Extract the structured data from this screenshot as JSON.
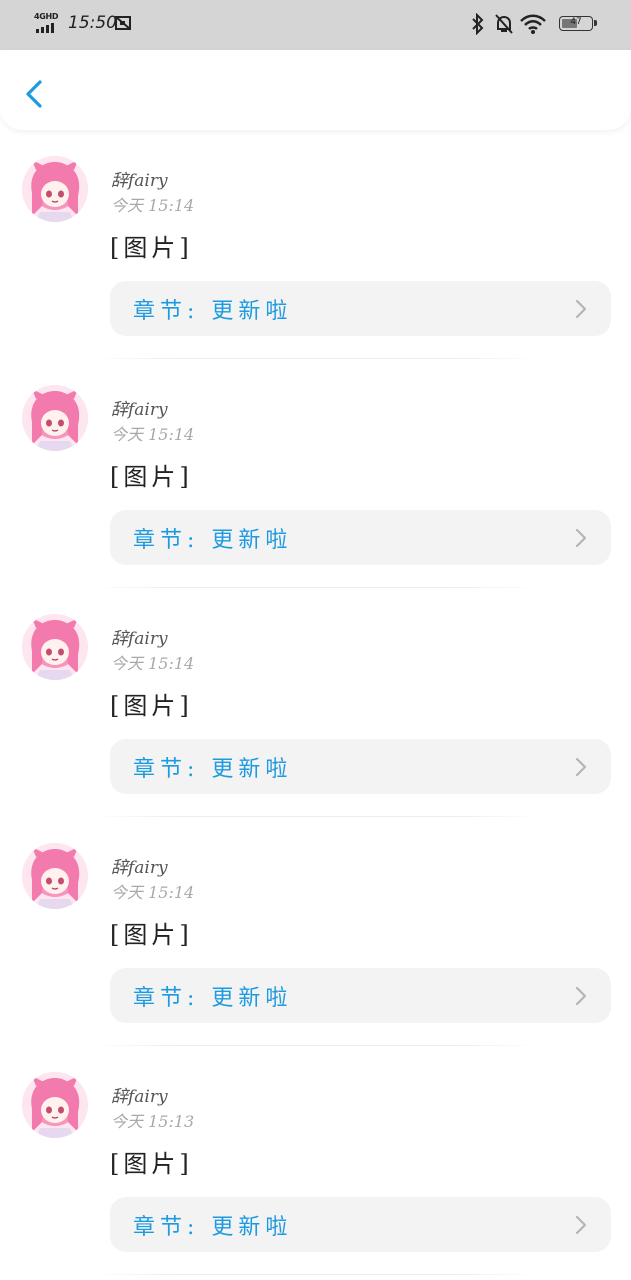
{
  "status_bar": {
    "network": "4GHD",
    "time": "15:50",
    "battery": "47",
    "battery_level": 0.47
  },
  "items": [
    {
      "name": "辞fairy",
      "time": "今天 15:14",
      "content": "[图片]",
      "chapter": "章节: 更新啦"
    },
    {
      "name": "辞fairy",
      "time": "今天 15:14",
      "content": "[图片]",
      "chapter": "章节: 更新啦"
    },
    {
      "name": "辞fairy",
      "time": "今天 15:14",
      "content": "[图片]",
      "chapter": "章节: 更新啦"
    },
    {
      "name": "辞fairy",
      "time": "今天 15:14",
      "content": "[图片]",
      "chapter": "章节: 更新啦"
    },
    {
      "name": "辞fairy",
      "time": "今天 15:13",
      "content": "[图片]",
      "chapter": "章节: 更新啦"
    }
  ],
  "colors": {
    "accent": "#1e9be0",
    "status_bar_bg": "#d5d5d5",
    "card_bg": "#f3f3f3"
  },
  "icons": {
    "back": "back-arrow-icon",
    "chevron": "chevron-right-icon",
    "bluetooth": "bluetooth-icon",
    "mute": "bell-off-icon",
    "wifi": "wifi-icon",
    "battery": "battery-icon"
  }
}
